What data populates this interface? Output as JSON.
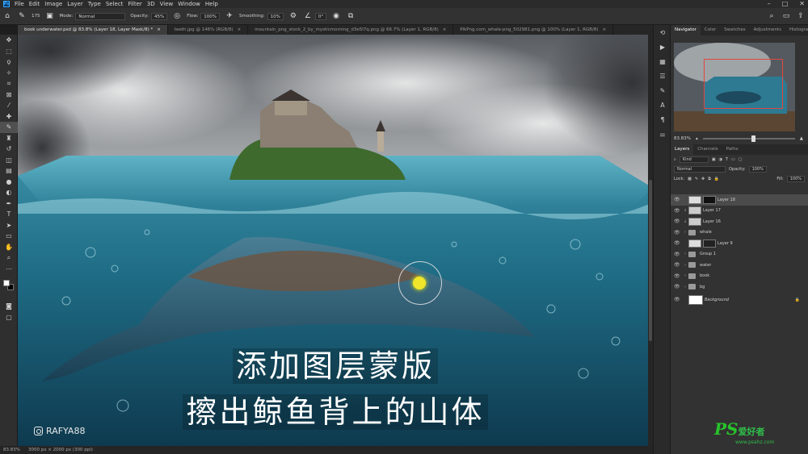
{
  "menu": {
    "app_icon": "Ps",
    "items": [
      "File",
      "Edit",
      "Image",
      "Layer",
      "Type",
      "Select",
      "Filter",
      "3D",
      "View",
      "Window",
      "Help"
    ]
  },
  "options_bar": {
    "brush_size": "175",
    "mode_label": "Mode:",
    "mode_value": "Normal",
    "opacity_label": "Opacity:",
    "opacity_value": "45%",
    "flow_label": "Flow:",
    "flow_value": "100%",
    "smoothing_label": "Smoothing:",
    "smoothing_value": "10%",
    "angle_value": "0°"
  },
  "tabs": [
    {
      "label": "book underwater.psd @ 83.8% (Layer 18, Layer Mask/8) *",
      "active": true
    },
    {
      "label": "teeth.jpg @ 146% (RGB/8)",
      "active": false
    },
    {
      "label": "mountain_png_stock_2_by_mysticmorning_d3e5l7q.png @ 66.7% (Layer 1, RGB/8)",
      "active": false
    },
    {
      "label": "PikPng.com_whale-png_502981.png @ 100% (Layer 1, RGB/8)",
      "active": false
    }
  ],
  "tab_close": "×",
  "subtitles": {
    "line1": "添加图层蒙版",
    "line2": "擦出鲸鱼背上的山体"
  },
  "watermark": "RAFYA88",
  "status": {
    "zoom": "83.83%",
    "doc": "3000 px × 2000 px (300 ppi)"
  },
  "panels": {
    "top_tabs": [
      "Navigator",
      "Color",
      "Swatches",
      "Adjustments",
      "Histogram"
    ],
    "zoom_value": "83.83%",
    "layer_tabs": [
      "Layers",
      "Channels",
      "Paths"
    ],
    "kind_label": "Kind",
    "blend_value": "Normal",
    "opacity_label": "Opacity:",
    "opacity_value": "100%",
    "lock_label": "Lock:",
    "fill_label": "Fill:",
    "fill_value": "100%"
  },
  "layers": [
    {
      "name": "Layer 18",
      "selected": true,
      "kind": "layer"
    },
    {
      "name": "Layer 17",
      "selected": false,
      "kind": "layer"
    },
    {
      "name": "Layer 16",
      "selected": false,
      "kind": "layer"
    },
    {
      "name": "whale",
      "selected": false,
      "kind": "group"
    },
    {
      "name": "Layer 9",
      "selected": false,
      "kind": "layer"
    },
    {
      "name": "Group 1",
      "selected": false,
      "kind": "group"
    },
    {
      "name": "water",
      "selected": false,
      "kind": "group"
    },
    {
      "name": "book",
      "selected": false,
      "kind": "group"
    },
    {
      "name": "bg",
      "selected": false,
      "kind": "group"
    },
    {
      "name": "Background",
      "selected": false,
      "kind": "background"
    }
  ],
  "site_logo": {
    "mark": "PS",
    "text": "爱好者",
    "url": "www.psahz.com"
  },
  "colors": {
    "accent": "#31a8ff",
    "nav_frame": "#e0473f",
    "brush_dot": "#f0e52a"
  }
}
